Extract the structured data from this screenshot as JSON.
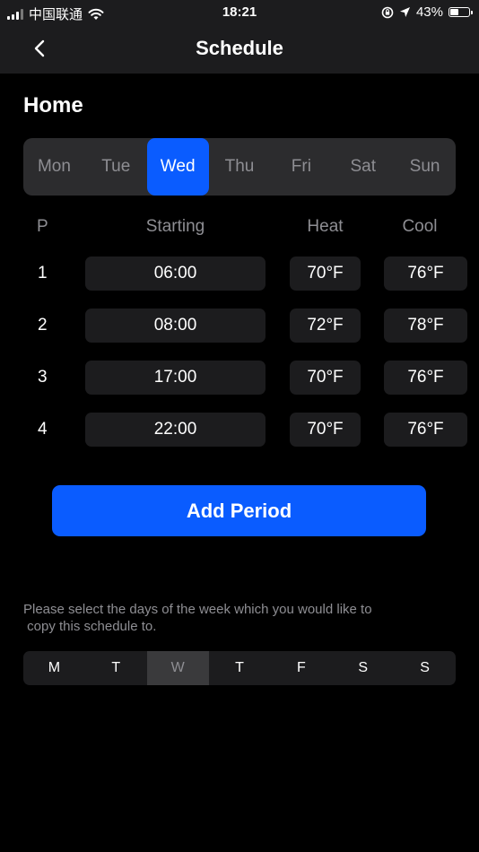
{
  "status_bar": {
    "carrier": "中国联通",
    "time": "18:21",
    "battery": "43%",
    "battery_level": 0.43
  },
  "nav": {
    "title": "Schedule",
    "back_icon": "chevron-left-icon"
  },
  "section_title": "Home",
  "days": [
    "Mon",
    "Tue",
    "Wed",
    "Thu",
    "Fri",
    "Sat",
    "Sun"
  ],
  "selected_day": "Wed",
  "table": {
    "headers": {
      "period": "P",
      "starting": "Starting",
      "heat": "Heat",
      "cool": "Cool"
    },
    "rows": [
      {
        "period": "1",
        "start": "06:00",
        "heat": "70°F",
        "cool": "76°F"
      },
      {
        "period": "2",
        "start": "08:00",
        "heat": "72°F",
        "cool": "78°F"
      },
      {
        "period": "3",
        "start": "17:00",
        "heat": "70°F",
        "cool": "76°F"
      },
      {
        "period": "4",
        "start": "22:00",
        "heat": "70°F",
        "cool": "76°F"
      }
    ]
  },
  "add_button": "Add Period",
  "copy_note": "Please select the days of the week which you would like to\n copy this schedule to.",
  "copy_days": [
    "M",
    "T",
    "W",
    "T",
    "F",
    "S",
    "S"
  ],
  "copy_days_current_index": 2,
  "colors": {
    "accent": "#0a5cff",
    "background": "#000000",
    "surface": "#1c1c1e"
  }
}
